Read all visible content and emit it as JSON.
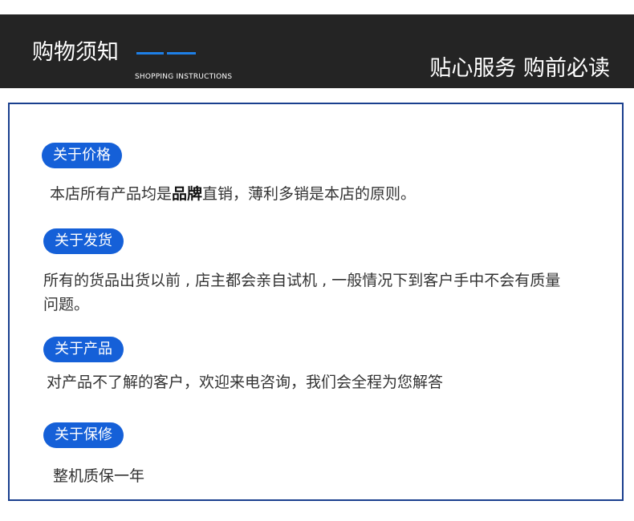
{
  "header": {
    "title": "购物须知",
    "subtitle": "SHOPPING INSTRUCTIONS",
    "right_text": "贴心服务  购前必读",
    "line_color": "#1e7fe6",
    "background": "#242424"
  },
  "sections": [
    {
      "badge": "关于价格",
      "text_before": "本店所有产品均是",
      "text_bold": "品牌",
      "text_after": "直销，薄利多销是本店的原则。"
    },
    {
      "badge": "关于发货",
      "text": "所有的货品出货以前 , 店主都会亲自试机 , 一般情况下到客户手中不会有质量问题。"
    },
    {
      "badge": "关于产品",
      "text": "对产品不了解的客户，欢迎来电咨询，我们会全程为您解答"
    },
    {
      "badge": "关于保修",
      "text": "整机质保一年"
    }
  ],
  "colors": {
    "badge": "#1560d8",
    "border": "#1a3f8e",
    "text": "#333333"
  }
}
